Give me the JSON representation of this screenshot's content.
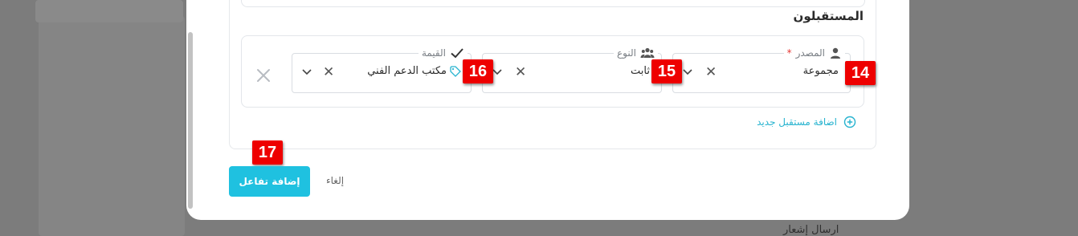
{
  "background": {
    "peek_text": "ارسال إشعار"
  },
  "section": {
    "title": "المستقبلون"
  },
  "recipient_row": {
    "source": {
      "label": "المصدر",
      "required_mark": "*",
      "value": "مجموعة",
      "icon": "user-icon",
      "badge": "14"
    },
    "type": {
      "label": "النوع",
      "value": "ثابت",
      "icon": "users-group-icon",
      "badge": "15"
    },
    "value": {
      "label": "القيمة",
      "value": "مكتب الدعم الفني",
      "icon": "check-icon",
      "tag_icon": "tag-icon",
      "badge": "16"
    }
  },
  "add_recipient": {
    "label": "اضافة مستقبل جديد",
    "icon": "plus-circle-icon"
  },
  "footer": {
    "submit_label": "إضافة تفاعل",
    "submit_badge": "17",
    "cancel_label": "إلغاء"
  },
  "colors": {
    "accent": "#1fc1e0",
    "link": "#26b3cf",
    "badge": "#ee0000",
    "required": "#e53935"
  }
}
